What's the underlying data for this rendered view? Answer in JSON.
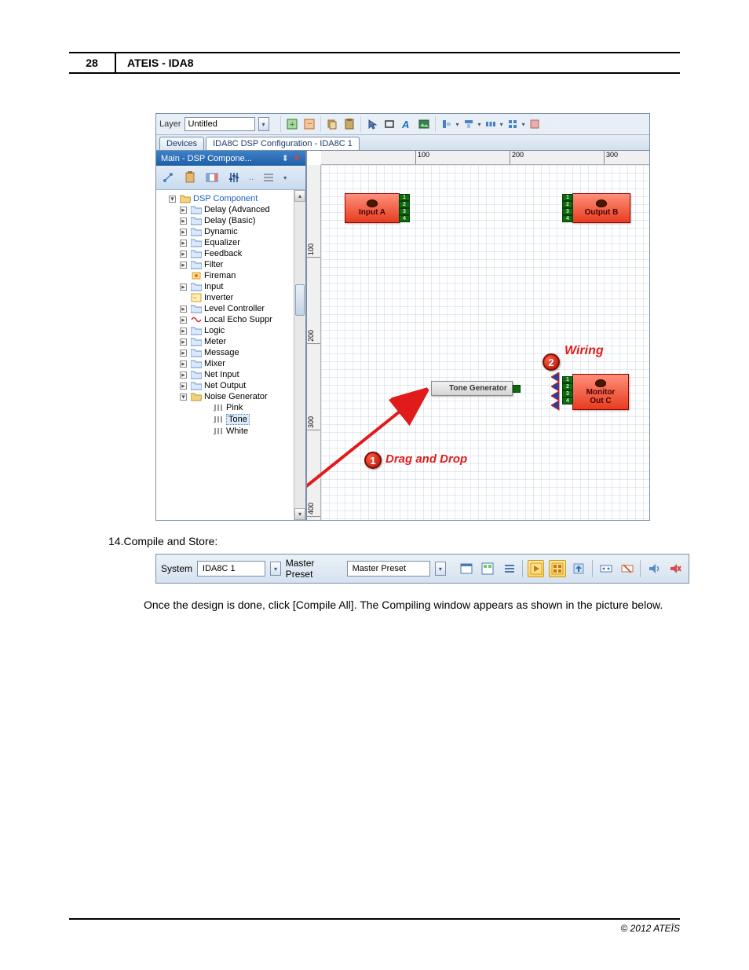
{
  "page": {
    "number": "28",
    "title": "ATEIS - IDA8"
  },
  "step": {
    "number": "14.",
    "label": "Compile and Store:"
  },
  "body_paragraph": "Once the design is done, click [Compile All]. The Compiling window appears as shown in the picture below.",
  "footer": "© 2012 ATEÏS",
  "app": {
    "layer_label": "Layer",
    "layer_value": "Untitled",
    "tabs": [
      "Devices",
      "IDA8C DSP Configuration - IDA8C 1"
    ],
    "panel_title": "Main - DSP Compone...",
    "tree_root": "DSP Component",
    "tree_items": [
      "Delay (Advanced",
      "Delay (Basic)",
      "Dynamic",
      "Equalizer",
      "Feedback",
      "Filter",
      "Fireman",
      "Input",
      "Inverter",
      "Level Controller",
      "Local Echo Suppr",
      "Logic",
      "Meter",
      "Message",
      "Mixer",
      "Net Input",
      "Net Output",
      "Noise Generator"
    ],
    "noise_children": [
      "Pink",
      "Tone",
      "White"
    ],
    "ruler_h": {
      "t100": "100",
      "t200": "200",
      "t300": "300"
    },
    "ruler_v": {
      "t100": "100",
      "t200": "200",
      "t300": "300",
      "t400": "400"
    },
    "blocks": {
      "input_a": "Input A",
      "output_b": "Output B",
      "tone_gen": "Tone Generator",
      "monitor": "Monitor",
      "out_c": "Out C"
    },
    "callouts": {
      "c1": "1",
      "c1_label": "Drag and Drop",
      "c2": "2",
      "c2_label": "Wiring"
    }
  },
  "status": {
    "system_label": "System",
    "system_value": "IDA8C 1",
    "preset_label": "Master Preset",
    "preset_value": "Master Preset"
  }
}
